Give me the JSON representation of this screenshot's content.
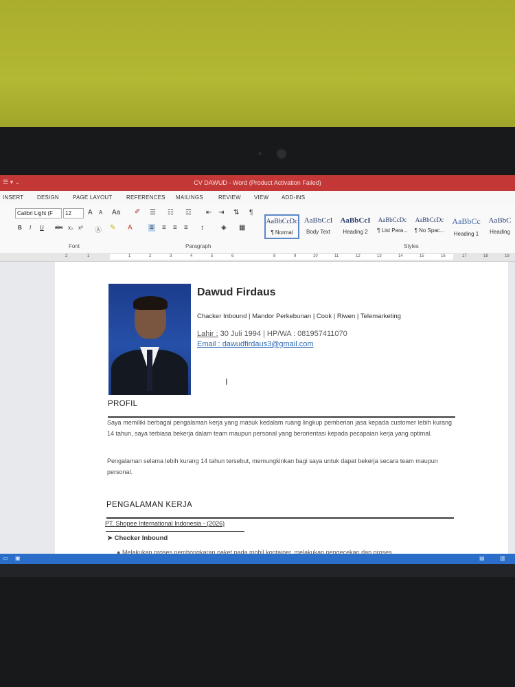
{
  "window": {
    "title": "CV DAWUD - Word (Product Activation Failed)"
  },
  "ribbon_tabs": [
    "INSERT",
    "DESIGN",
    "PAGE LAYOUT",
    "REFERENCES",
    "MAILINGS",
    "REVIEW",
    "VIEW",
    "ADD-INS"
  ],
  "font": {
    "name": "Calibri Light (F",
    "size": "12",
    "grow": "A",
    "shrink": "A",
    "case": "Aa",
    "group_label": "Font"
  },
  "format_buttons": {
    "bold": "B",
    "italic": "I",
    "underline": "U",
    "strike": "abc",
    "sub": "x₂",
    "sup": "x²"
  },
  "paragraph": {
    "group_label": "Paragraph"
  },
  "styles": {
    "group_label": "Styles",
    "items": [
      {
        "preview": "AaBbCcDc",
        "name": "¶ Normal"
      },
      {
        "preview": "AaBbCcI",
        "name": "Body Text"
      },
      {
        "preview": "AaBbCcI",
        "name": "Heading 2"
      },
      {
        "preview": "AaBbCcDc",
        "name": "¶ List Para..."
      },
      {
        "preview": "AaBbCcDc",
        "name": "¶ No Spac..."
      },
      {
        "preview": "AaBbCc",
        "name": "Heading 1"
      },
      {
        "preview": "AaBbC",
        "name": "Heading"
      }
    ]
  },
  "ruler_numbers": [
    "2",
    "1",
    "1",
    "2",
    "3",
    "4",
    "5",
    "6",
    "8",
    "9",
    "10",
    "11",
    "12",
    "13",
    "14",
    "15",
    "16",
    "17",
    "18",
    "19"
  ],
  "cv": {
    "name": "Dawud Firdaus",
    "roles": "Chacker Inbound | Mandor Perkebunan | Cook | Riwen | Telemarketing",
    "birth_label": "Lahir :",
    "birth_text": "30 Juli 1994 | HP/WA : 081957411070",
    "email_label": "Email :",
    "email": "dawudfirdaus3@gmail.com",
    "profil_heading": "PROFIL",
    "profil_p1": "Saya memiliki berbagai pengalaman kerja yang masuk kedalam ruang lingkup pemberian jasa kepada customer lebih kurang 14 tahun, saya terbiasa bekerja dalam team maupun personal yang berorientasi kepada pecapaian kerja yang optimal.",
    "profil_p2": "Pengalaman selama lebih kurang 14 tahun tersebut, memungkinkan bagi saya untuk dapat bekerja secara team maupun personal.",
    "exp_heading": "PENGALAMAN KERJA",
    "company": "PT. Shopee International Indonesia - (2026)",
    "job_title": "Checker Inbound",
    "bullet": "Melakukan proses pembongkaran paket pada mobil kontainer, melakukan pengecekan dan proses"
  },
  "colors": {
    "title_bar": "#c43737",
    "status_bar": "#2b6ec9",
    "wall": "#b3b833"
  }
}
